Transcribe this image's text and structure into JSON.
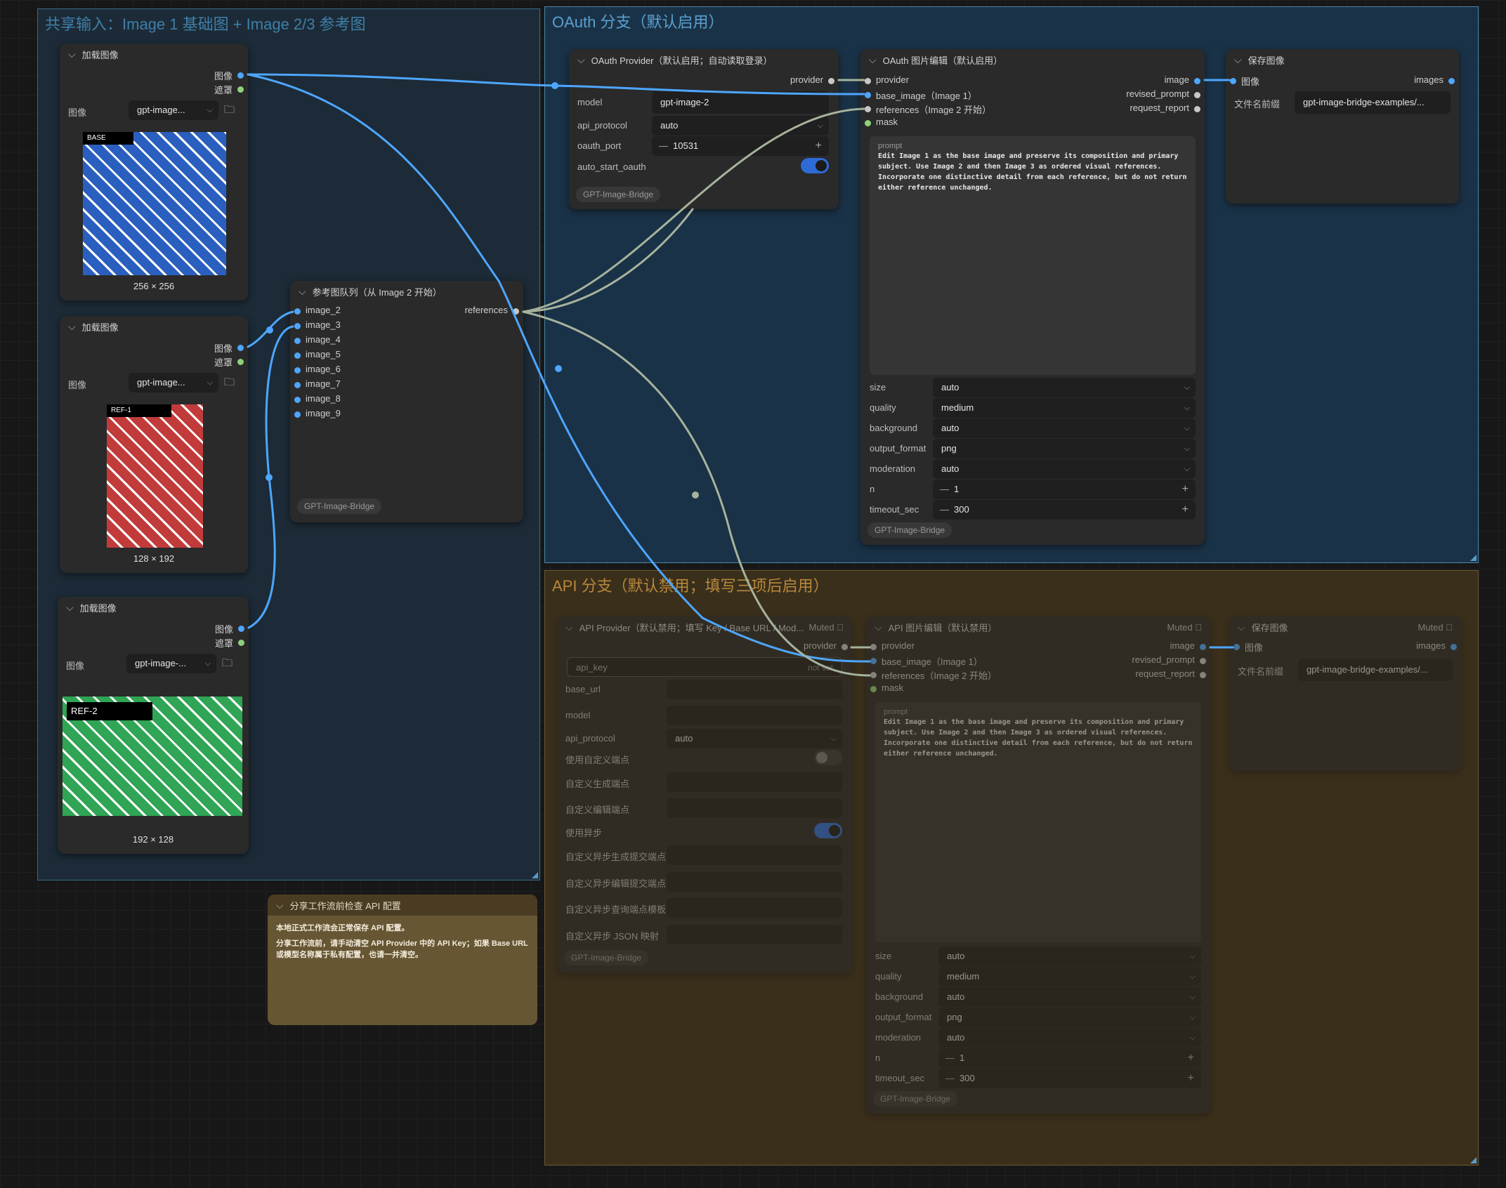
{
  "groups": {
    "shared": "共享输入：Image 1 基础图 + Image 2/3 参考图",
    "oauth": "OAuth 分支（默认启用）",
    "api": "API 分支（默认禁用；填写三项后启用）"
  },
  "load_image_1": {
    "title": "加载图像",
    "out_image": "图像",
    "out_mask": "遮罩",
    "widget_label": "图像",
    "file": "gpt-image...",
    "tag": "BASE",
    "dims": "256 × 256",
    "color": "#2a5fbf"
  },
  "load_image_2": {
    "title": "加载图像",
    "out_image": "图像",
    "out_mask": "遮罩",
    "widget_label": "图像",
    "file": "gpt-image...",
    "tag": "REF-1",
    "dims": "128 × 192",
    "color": "#c23b3b"
  },
  "load_image_3": {
    "title": "加载图像",
    "out_image": "图像",
    "out_mask": "遮罩",
    "widget_label": "图像",
    "file": "gpt-image-...",
    "tag": "REF-2",
    "dims": "192 × 128",
    "color": "#2fa555"
  },
  "ref_queue": {
    "title": "参考图队列（从 Image 2 开始）",
    "inputs": [
      "image_2",
      "image_3",
      "image_4",
      "image_5",
      "image_6",
      "image_7",
      "image_8",
      "image_9"
    ],
    "output": "references",
    "badge": "GPT-Image-Bridge"
  },
  "oauth_provider": {
    "title": "OAuth Provider（默认启用；自动读取登录）",
    "output": "provider",
    "model_label": "model",
    "model": "gpt-image-2",
    "api_protocol_label": "api_protocol",
    "api_protocol": "auto",
    "oauth_port_label": "oauth_port",
    "oauth_port": "10531",
    "auto_start_label": "auto_start_oauth",
    "auto_start": true,
    "badge": "GPT-Image-Bridge"
  },
  "oauth_edit": {
    "title": "OAuth 图片编辑（默认启用）",
    "inputs": [
      "provider",
      "base_image（Image 1）",
      "references（Image 2 开始）",
      "mask"
    ],
    "outputs": [
      "image",
      "revised_prompt",
      "request_report"
    ],
    "prompt_label": "prompt",
    "prompt": "Edit Image 1 as the base image and preserve its composition and primary subject. Use Image 2 and then Image 3 as ordered visual references. Incorporate one distinctive detail from each reference, but do not return either reference unchanged.",
    "settings": [
      {
        "label": "size",
        "value": "auto"
      },
      {
        "label": "quality",
        "value": "medium"
      },
      {
        "label": "background",
        "value": "auto"
      },
      {
        "label": "output_format",
        "value": "png"
      },
      {
        "label": "moderation",
        "value": "auto"
      }
    ],
    "n_label": "n",
    "n": "1",
    "timeout_label": "timeout_sec",
    "timeout": "300",
    "badge": "GPT-Image-Bridge"
  },
  "oauth_save": {
    "title": "保存图像",
    "input": "图像",
    "output": "images",
    "prefix_label": "文件名前缀",
    "prefix": "gpt-image-bridge-examples/..."
  },
  "api_provider": {
    "title": "API Provider（默认禁用；填写 Key / Base URL / Mod...",
    "muted": "Muted ⃠",
    "output": "provider",
    "api_key_label": "api_key",
    "api_key_value": "not set",
    "base_url_label": "base_url",
    "model_label": "model",
    "api_protocol_label": "api_protocol",
    "api_protocol": "auto",
    "use_custom_endpoint": "使用自定义端点",
    "custom_gen": "自定义生成端点",
    "custom_edit": "自定义编辑端点",
    "use_async": "使用异步",
    "async_gen": "自定义异步生成提交端点",
    "async_edit": "自定义异步编辑提交端点",
    "async_query": "自定义异步查询端点模板",
    "async_json": "自定义异步 JSON 映射",
    "badge": "GPT-Image-Bridge"
  },
  "api_edit": {
    "title": "API 图片编辑（默认禁用）",
    "muted": "Muted ⃠",
    "inputs": [
      "provider",
      "base_image（Image 1）",
      "references（Image 2 开始）",
      "mask"
    ],
    "outputs": [
      "image",
      "revised_prompt",
      "request_report"
    ],
    "prompt_label": "prompt",
    "prompt": "Edit Image 1 as the base image and preserve its composition and primary subject. Use Image 2 and then Image 3 as ordered visual references. Incorporate one distinctive detail from each reference, but do not return either reference unchanged.",
    "settings": [
      {
        "label": "size",
        "value": "auto"
      },
      {
        "label": "quality",
        "value": "medium"
      },
      {
        "label": "background",
        "value": "auto"
      },
      {
        "label": "output_format",
        "value": "png"
      },
      {
        "label": "moderation",
        "value": "auto"
      }
    ],
    "n_label": "n",
    "n": "1",
    "timeout_label": "timeout_sec",
    "timeout": "300",
    "badge": "GPT-Image-Bridge"
  },
  "api_save": {
    "title": "保存图像",
    "muted": "Muted ⃠",
    "input": "图像",
    "output": "images",
    "prefix_label": "文件名前缀",
    "prefix": "gpt-image-bridge-examples/..."
  },
  "note": {
    "title": "分享工作流前检查 API 配置",
    "line1": "本地正式工作流会正常保存 API 配置。",
    "line2": "分享工作流前，请手动清空 API Provider 中的 API Key；如果 Base URL 或模型名称属于私有配置，也请一并清空。"
  },
  "colors": {
    "image_wire": "#4ea6ff",
    "provider_wire": "#a6b39c",
    "mask_slot": "#8fd17a"
  }
}
